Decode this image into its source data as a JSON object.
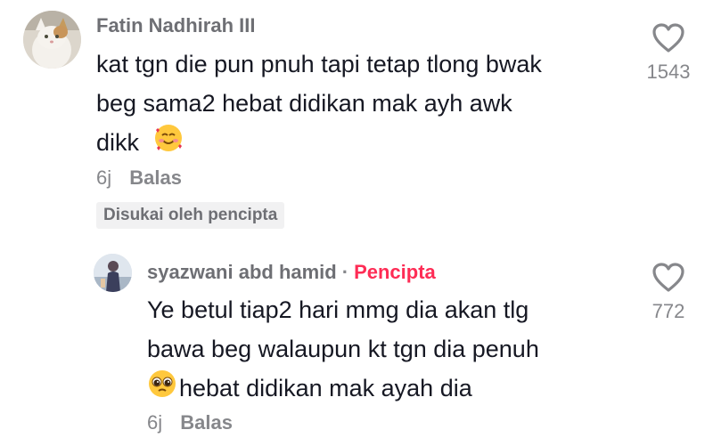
{
  "comments": [
    {
      "username": "Fatin Nadhirah III",
      "lines": [
        "kat tgn die pun pnuh tapi tetap tlong bwak",
        "beg sama2 hebat didikan mak ayh awk",
        "dikk"
      ],
      "emoji": "smiling-face-with-hearts-emoji",
      "time": "6j",
      "reply_label": "Balas",
      "liked_badge": "Disukai oleh pencipta",
      "like_count": "1543"
    },
    {
      "username": "syazwani abd hamid",
      "separator": "·",
      "creator_label": "Pencipta",
      "lines": [
        "Ye betul tiap2 hari mmg dia akan tlg",
        "bawa beg walaupun kt tgn dia penuh",
        "hebat didikan mak ayah dia"
      ],
      "emoji": "pleading-face-emoji",
      "time": "6j",
      "reply_label": "Balas",
      "like_count": "772"
    }
  ]
}
